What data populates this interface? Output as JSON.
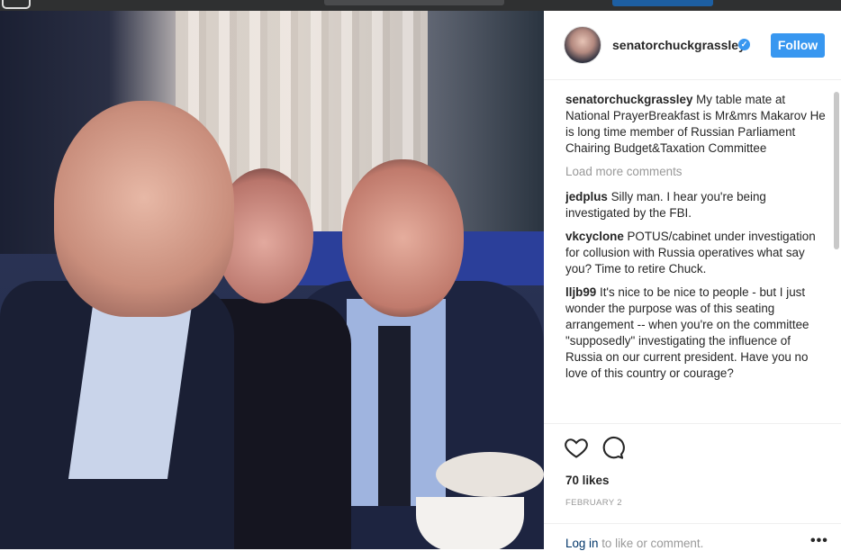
{
  "post": {
    "username": "senatorchuckgrassley",
    "verified_glyph": "✓",
    "follow_label": "Follow",
    "caption": "My table mate at National PrayerBreakfast is Mr&mrs Makarov He is long time member of Russian Parliament Chairing Budget&Taxation Committee",
    "load_more": "Load more comments",
    "comments": [
      {
        "user": "jedplus",
        "text": "Silly man. I hear you're being investigated by the FBI."
      },
      {
        "user": "vkcyclone",
        "text": "POTUS/cabinet under investigation for collusion with Russia operatives what say you? Time to retire Chuck."
      },
      {
        "user": "lljb99",
        "text": "It's nice to be nice to people - but I just wonder the purpose was of this seating arrangement -- when you're on the committee \"supposedly\" investigating the influence of Russia on our current president. Have you no love of this country or courage?"
      }
    ],
    "likes": "70 likes",
    "date": "FEBRUARY 2",
    "login_link": "Log in",
    "login_rest": " to like or comment.",
    "more_glyph": "•••",
    "icons": {
      "heart": "heart-icon",
      "comment": "comment-icon",
      "verified": "verified-badge-icon",
      "options": "options-icon"
    },
    "colors": {
      "accent": "#3897f0",
      "muted": "#999999",
      "text": "#262626"
    }
  }
}
